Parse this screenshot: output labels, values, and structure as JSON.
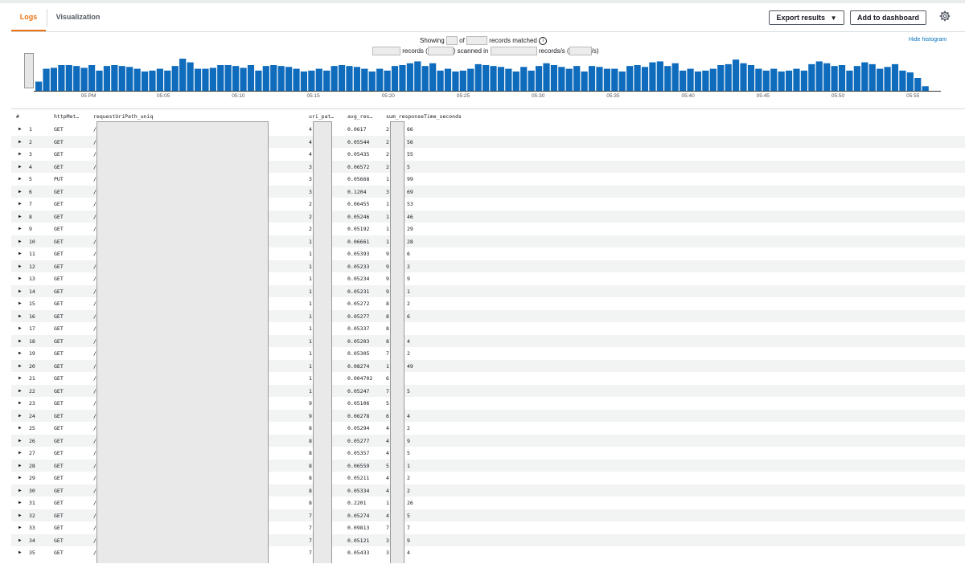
{
  "tabs": {
    "logs": "Logs",
    "visualization": "Visualization"
  },
  "toolbar": {
    "export_label": "Export results",
    "export_caret": "▼",
    "dashboard_label": "Add to dashboard"
  },
  "histogram": {
    "hide_label": "Hide histogram",
    "status": {
      "showing": "Showing",
      "of": "of",
      "records_matched": "records matched",
      "records": "records (",
      "scanned_in": ") scanned in",
      "records_per_s": "records/s (",
      "per_s": "/s)"
    },
    "ticks": [
      "05 PM",
      "05:05",
      "05:10",
      "05:15",
      "05:20",
      "05:25",
      "05:30",
      "05:35",
      "05:40",
      "05:45",
      "05:50",
      "05:55"
    ],
    "bars": [
      10,
      24,
      25,
      28,
      28,
      27,
      25,
      28,
      22,
      27,
      28,
      27,
      26,
      24,
      21,
      22,
      24,
      22,
      27,
      35,
      31,
      24,
      24,
      25,
      28,
      28,
      27,
      25,
      28,
      22,
      27,
      28,
      27,
      26,
      24,
      21,
      22,
      24,
      22,
      27,
      28,
      27,
      26,
      24,
      21,
      24,
      22,
      27,
      28,
      30,
      32,
      27,
      30,
      22,
      24,
      21,
      22,
      24,
      29,
      28,
      27,
      26,
      24,
      21,
      26,
      22,
      27,
      30,
      28,
      26,
      24,
      27,
      21,
      27,
      26,
      24,
      24,
      21,
      27,
      28,
      26,
      31,
      32,
      27,
      30,
      22,
      24,
      21,
      22,
      24,
      28,
      29,
      34,
      30,
      28,
      24,
      22,
      24,
      21,
      22,
      24,
      22,
      29,
      32,
      30,
      27,
      28,
      22,
      27,
      31,
      29,
      24,
      26,
      29,
      22,
      20,
      14,
      5
    ],
    "bar_color": "#0f6cbd"
  },
  "table": {
    "headers": {
      "num": "#",
      "method": "httpMet…",
      "uri": "requestUriPath_uniq",
      "uri_pat": "uri_pat…",
      "avg": "avg_res…",
      "sum": "sum_responseTime_seconds"
    },
    "rows": [
      {
        "n": "1",
        "m": "GET",
        "u": "/",
        "c": "4",
        "a": "0.0617",
        "s1": "2",
        "s2": "66"
      },
      {
        "n": "2",
        "m": "GET",
        "u": "/",
        "c": "4",
        "a": "0.05544",
        "s1": "2",
        "s2": "56"
      },
      {
        "n": "3",
        "m": "GET",
        "u": "/",
        "c": "4",
        "a": "0.05435",
        "s1": "2",
        "s2": "55"
      },
      {
        "n": "4",
        "m": "GET",
        "u": "/",
        "c": "3",
        "a": "0.06572",
        "s1": "2",
        "s2": "5"
      },
      {
        "n": "5",
        "m": "PUT",
        "u": "/",
        "c": "3",
        "a": "0.05668",
        "s1": "1",
        "s2": "99"
      },
      {
        "n": "6",
        "m": "GET",
        "u": "/",
        "c": "3",
        "a": "0.1204",
        "s1": "3",
        "s2": "69"
      },
      {
        "n": "7",
        "m": "GET",
        "u": "/",
        "c": "2",
        "a": "0.06455",
        "s1": "1",
        "s2": "53"
      },
      {
        "n": "8",
        "m": "GET",
        "u": "/",
        "c": "2",
        "a": "0.05246",
        "s1": "1",
        "s2": "46"
      },
      {
        "n": "9",
        "m": "GET",
        "u": "/",
        "c": "2",
        "a": "0.05192",
        "s1": "1",
        "s2": "29"
      },
      {
        "n": "10",
        "m": "GET",
        "u": "/",
        "c": "1",
        "a": "0.06661",
        "s1": "1",
        "s2": "28"
      },
      {
        "n": "11",
        "m": "GET",
        "u": "/",
        "c": "1",
        "a": "0.05393",
        "s1": "9",
        "s2": "6"
      },
      {
        "n": "12",
        "m": "GET",
        "u": "/",
        "c": "1",
        "a": "0.05233",
        "s1": "9",
        "s2": "2"
      },
      {
        "n": "13",
        "m": "GET",
        "u": "/",
        "c": "1",
        "a": "0.05234",
        "s1": "9",
        "s2": "9"
      },
      {
        "n": "14",
        "m": "GET",
        "u": "/",
        "c": "1",
        "a": "0.05231",
        "s1": "9",
        "s2": "1"
      },
      {
        "n": "15",
        "m": "GET",
        "u": "/",
        "c": "1",
        "a": "0.05272",
        "s1": "8",
        "s2": "2"
      },
      {
        "n": "16",
        "m": "GET",
        "u": "/",
        "c": "1",
        "a": "0.05277",
        "s1": "8",
        "s2": "6"
      },
      {
        "n": "17",
        "m": "GET",
        "u": "/",
        "c": "1",
        "a": "0.05337",
        "s1": "8",
        "s2": ""
      },
      {
        "n": "18",
        "m": "GET",
        "u": "/",
        "c": "1",
        "a": "0.05203",
        "s1": "8",
        "s2": "4"
      },
      {
        "n": "19",
        "m": "GET",
        "u": "/",
        "c": "1",
        "a": "0.05305",
        "s1": "7",
        "s2": "2"
      },
      {
        "n": "20",
        "m": "GET",
        "u": "/",
        "c": "1",
        "a": "0.08274",
        "s1": "1",
        "s2": "49"
      },
      {
        "n": "21",
        "m": "GET",
        "u": "/",
        "c": "1",
        "a": "0.004702",
        "s1": "6",
        "s2": ""
      },
      {
        "n": "22",
        "m": "GET",
        "u": "/",
        "c": "1",
        "a": "0.05247",
        "s1": "7",
        "s2": "5"
      },
      {
        "n": "23",
        "m": "GET",
        "u": "/",
        "c": "9",
        "a": "0.05106",
        "s1": "5",
        "s2": ""
      },
      {
        "n": "24",
        "m": "GET",
        "u": "/",
        "c": "9",
        "a": "0.06278",
        "s1": "6",
        "s2": "4"
      },
      {
        "n": "25",
        "m": "GET",
        "u": "/",
        "c": "8",
        "a": "0.05294",
        "s1": "4",
        "s2": "2"
      },
      {
        "n": "26",
        "m": "GET",
        "u": "/",
        "c": "8",
        "a": "0.05277",
        "s1": "4",
        "s2": "9"
      },
      {
        "n": "27",
        "m": "GET",
        "u": "/",
        "c": "8",
        "a": "0.05357",
        "s1": "4",
        "s2": "5"
      },
      {
        "n": "28",
        "m": "GET",
        "u": "/",
        "c": "8",
        "a": "0.06559",
        "s1": "5",
        "s2": "1"
      },
      {
        "n": "29",
        "m": "GET",
        "u": "/",
        "c": "8",
        "a": "0.05211",
        "s1": "4",
        "s2": "2"
      },
      {
        "n": "30",
        "m": "GET",
        "u": "/",
        "c": "8",
        "a": "0.05334",
        "s1": "4",
        "s2": "2"
      },
      {
        "n": "31",
        "m": "GET",
        "u": "/",
        "c": "8",
        "a": "0.2201",
        "s1": "1",
        "s2": "26"
      },
      {
        "n": "32",
        "m": "GET",
        "u": "/",
        "c": "7",
        "a": "0.05274",
        "s1": "4",
        "s2": "5"
      },
      {
        "n": "33",
        "m": "GET",
        "u": "/",
        "c": "7",
        "a": "0.09813",
        "s1": "7",
        "s2": "7"
      },
      {
        "n": "34",
        "m": "GET",
        "u": "/",
        "c": "7",
        "a": "0.05121",
        "s1": "3",
        "s2": "9"
      },
      {
        "n": "35",
        "m": "GET",
        "u": "/",
        "c": "7",
        "a": "0.05433",
        "s1": "3",
        "s2": "4"
      }
    ]
  }
}
